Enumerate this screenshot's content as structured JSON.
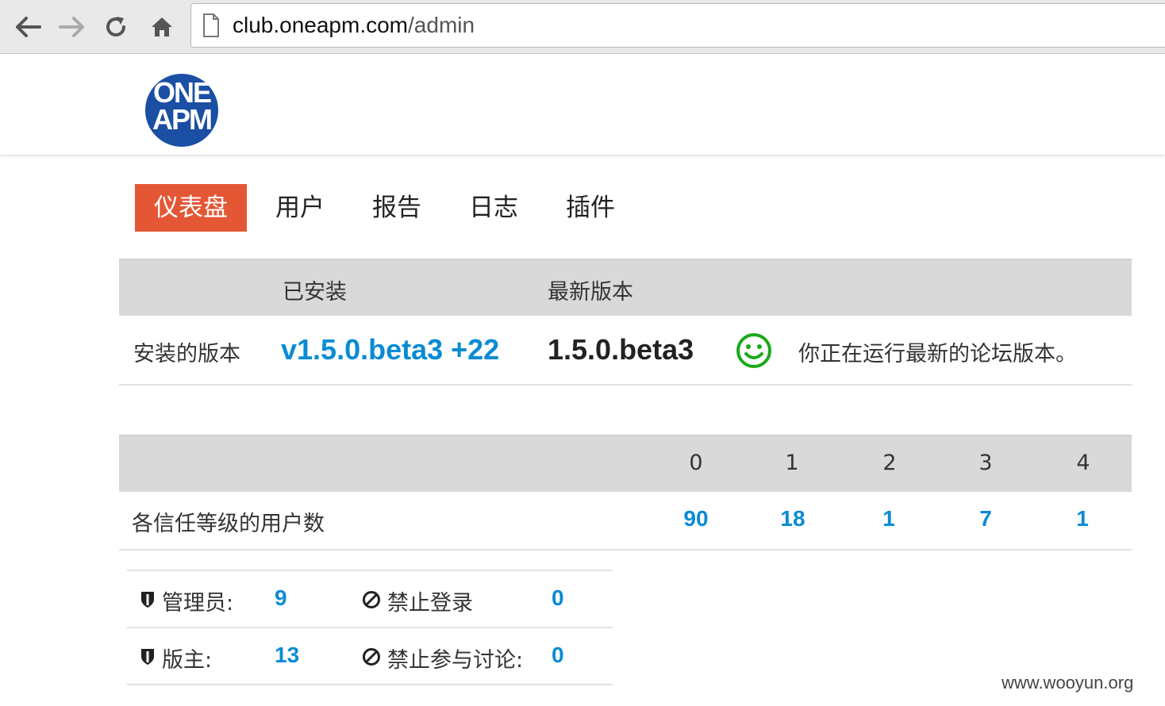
{
  "browser": {
    "url_host": "club.oneapm.com",
    "url_path": "/admin"
  },
  "logo": {
    "line1": "ONE",
    "line2": "APM",
    "color": "#1a4fa3"
  },
  "tabs": [
    {
      "label": "仪表盘",
      "active": true
    },
    {
      "label": "用户",
      "active": false
    },
    {
      "label": "报告",
      "active": false
    },
    {
      "label": "日志",
      "active": false
    },
    {
      "label": "插件",
      "active": false
    }
  ],
  "version_table": {
    "headers": {
      "installed": "已安装",
      "latest": "最新版本"
    },
    "row": {
      "label": "安装的版本",
      "installed": "v1.5.0.beta3 +22",
      "latest": "1.5.0.beta3",
      "status_icon": "smile-icon",
      "status": "你正在运行最新的论坛版本。"
    }
  },
  "trust_table": {
    "headers": [
      "0",
      "1",
      "2",
      "3",
      "4"
    ],
    "row": {
      "label": "各信任等级的用户数",
      "values": [
        "90",
        "18",
        "1",
        "7",
        "1"
      ]
    }
  },
  "stats": {
    "rows": [
      {
        "left_icon": "shield-icon",
        "left_label": "管理员:",
        "left_value": "9",
        "right_icon": "ban-icon",
        "right_label": "禁止登录",
        "right_value": "0"
      },
      {
        "left_icon": "shield-icon",
        "left_label": "版主:",
        "left_value": "13",
        "right_icon": "ban-icon",
        "right_label": "禁止参与讨论:",
        "right_value": "0"
      }
    ]
  },
  "watermark": "www.wooyun.org",
  "colors": {
    "accent": "#e45735",
    "link": "#0a8bd4",
    "success": "#1aaa1a",
    "header_bg": "#d9d9d9"
  }
}
